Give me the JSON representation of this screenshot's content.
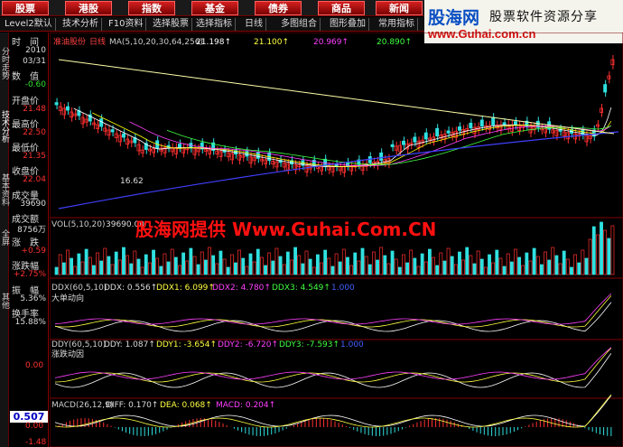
{
  "top_menu": [
    "股票",
    "港股",
    "指数",
    "基金",
    "债券",
    "商品",
    "新闻"
  ],
  "tabs": [
    "Level2默认",
    "技术分析",
    "F10资料",
    "选择股票",
    "选择指标",
    "日线",
    "多图组合",
    "图形叠加",
    "常用指标"
  ],
  "brand": {
    "logo": "股海网",
    "slogan": "股票软件资源分享",
    "url": "www.Guhai.com.cn"
  },
  "side_tabs": [
    "分时走势",
    "技术分析",
    "基本资料",
    "全屏",
    "其他"
  ],
  "info_panel": [
    {
      "label": "时　间",
      "value": "2010"
    },
    {
      "label": "",
      "value": "03/31"
    },
    {
      "label": "数　值",
      "value": "-0.60"
    },
    {
      "label": "开盘价",
      "value": "21.48"
    },
    {
      "label": "最高价",
      "value": "22.50"
    },
    {
      "label": "最低价",
      "value": "21.35"
    },
    {
      "label": "收盘价",
      "value": "22.04"
    },
    {
      "label": "成交量",
      "value": "39690"
    },
    {
      "label": "成交额",
      "value": "8756万"
    },
    {
      "label": "涨　跌",
      "value": "+0.59"
    },
    {
      "label": "涨跌幅",
      "value": "+2.75%"
    },
    {
      "label": "振　幅",
      "value": "5.36%"
    },
    {
      "label": "换手率",
      "value": "15.88%"
    }
  ],
  "probe_value": "0.507",
  "panels": {
    "main": {
      "stock": "准油股份",
      "period": "日线",
      "ma_label": "MA(5,10,20,30,64,256)",
      "ma": [
        {
          "name": "MA1",
          "value": "21.198↑"
        },
        {
          "name": "MA2",
          "value": "21.100↑"
        },
        {
          "name": "MA3",
          "value": "20.969↑"
        },
        {
          "name": "MA4",
          "value": "20.890↑"
        }
      ],
      "low_note": "16.62"
    },
    "vol": {
      "label": "VOL(5,10,20)",
      "value": "39690.00"
    },
    "ddx": {
      "label": "DDX(60,5,10)",
      "items": [
        "DDX: 0.556↑",
        "DDX1: 6.099↑",
        "DDX2: 4.780↑",
        "DDX3: 4.549↑",
        "1.000"
      ],
      "title": "大单动向"
    },
    "ddy": {
      "label": "DDY(60,5,10)",
      "items": [
        "DDY: 1.087↑",
        "DDY1: -3.654↑",
        "DDY2: -6.720↑",
        "DDY3: -7.593↑",
        "1.000"
      ],
      "title": "涨跌动因",
      "axis": "0.00"
    },
    "macd": {
      "label": "MACD(26,12,9)",
      "items": [
        "DIFF: 0.170↑",
        "DEA: 0.068↑",
        "MACD: 0.204↑"
      ],
      "axis_top": "0.00",
      "axis_bot": "-1.48"
    }
  },
  "watermark": "股海网提供 Www.Guhai.Com.CN",
  "colors": {
    "up": "#ff3030",
    "down": "#30e0e0",
    "ma1": "#ffffff",
    "ma2": "#ffff00",
    "ma3": "#ff40ff",
    "ma4": "#40ff40",
    "ma5": "#4040ff"
  }
}
